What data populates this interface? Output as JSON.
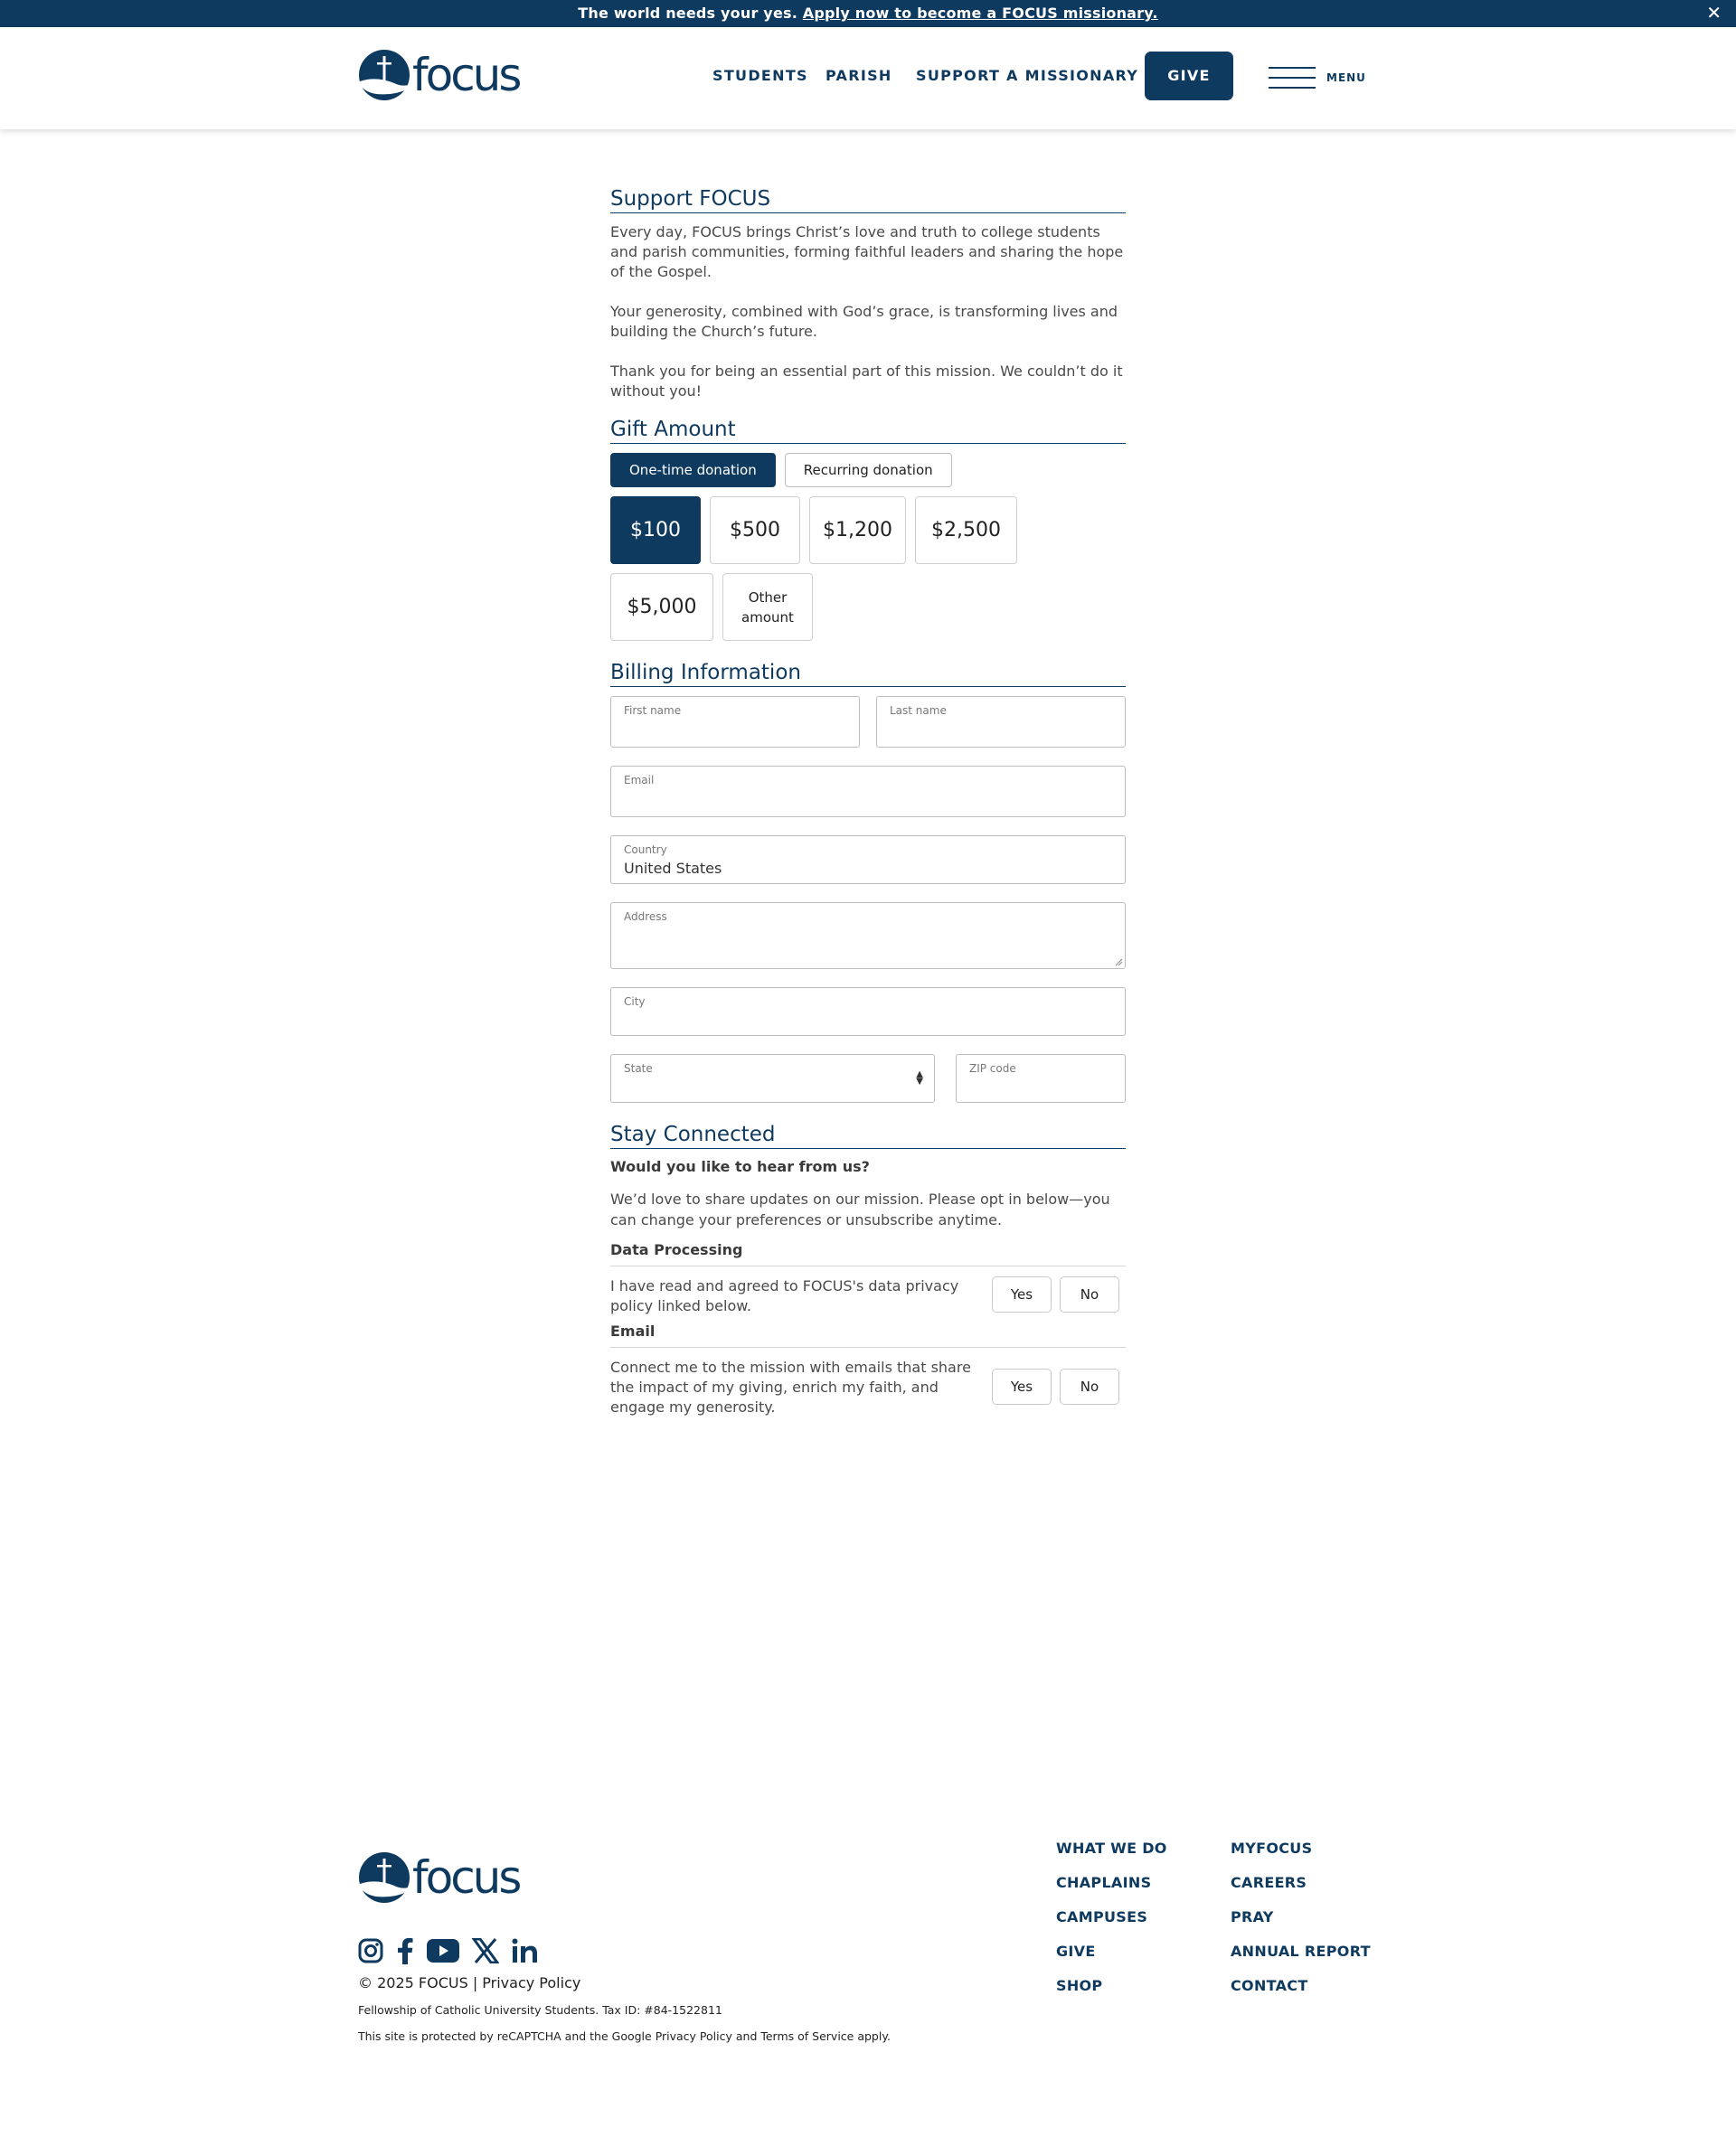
{
  "announcement": {
    "text": "The world needs your yes.",
    "link": "Apply now to become a FOCUS missionary.",
    "close": "✕"
  },
  "header": {
    "logo_text": "focus",
    "nav": [
      "STUDENTS",
      "PARISH",
      "SUPPORT A MISSIONARY"
    ],
    "give_label": "GIVE",
    "menu_label": "MENU"
  },
  "support": {
    "title": "Support FOCUS",
    "paragraphs": [
      "Every day, FOCUS brings Christ’s love and truth to college students and parish communities, forming faithful leaders and sharing the hope of the Gospel.",
      "Your generosity, combined with God’s grace, is transforming lives and building the Church’s future.",
      "Thank you for being an essential part of this mission. We couldn’t do it without you!"
    ]
  },
  "gift": {
    "title": "Gift Amount",
    "tabs": [
      "One-time donation",
      "Recurring donation"
    ],
    "selected_tab": "One-time donation",
    "amounts": [
      "$100",
      "$500",
      "$1,200",
      "$2,500",
      "$5,000"
    ],
    "other_line1": "Other",
    "other_line2": "amount",
    "selected_amount": "$100"
  },
  "billing": {
    "title": "Billing Information",
    "first_name_label": "First name",
    "last_name_label": "Last name",
    "email_label": "Email",
    "country_label": "Country",
    "country_value": "United States",
    "address_label": "Address",
    "city_label": "City",
    "state_label": "State",
    "zip_label": "ZIP code"
  },
  "connect": {
    "title": "Stay Connected",
    "question": "Would you like to hear from us?",
    "intro": "We’d love to share updates on our mission. Please opt in below—you can change your preferences or unsubscribe anytime.",
    "data_processing_title": "Data Processing",
    "data_processing_text": "I have read and agreed to FOCUS's data privacy policy linked below.",
    "email_title": "Email",
    "email_text": "Connect me to the mission with emails that share the impact of my giving, enrich my faith, and engage my generosity.",
    "yes": "Yes",
    "no": "No"
  },
  "footer": {
    "logo_text": "focus",
    "copyright": "© 2025 FOCUS | Privacy Policy",
    "fellowship": "Fellowship of Catholic University Students. Tax ID: #84-1522811",
    "recaptcha": "This site is protected by reCAPTCHA and the Google Privacy Policy and Terms of Service apply.",
    "links_col1": [
      "WHAT WE DO",
      "CHAPLAINS",
      "CAMPUSES",
      "GIVE",
      "SHOP"
    ],
    "links_col2": [
      "MYFOCUS",
      "CAREERS",
      "PRAY",
      "ANNUAL REPORT",
      "CONTACT"
    ],
    "social_icons": [
      "instagram-icon",
      "facebook-icon",
      "youtube-icon",
      "x-icon",
      "linkedin-icon"
    ]
  },
  "colors": {
    "brand": "#0f3a5f",
    "text": "#4a4a4a"
  }
}
